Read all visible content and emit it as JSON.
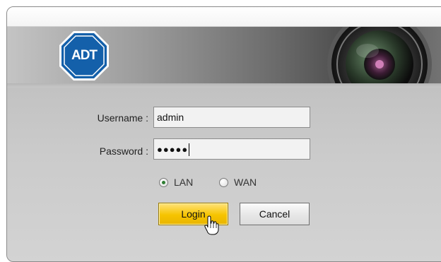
{
  "brand": {
    "logo_text": "ADT",
    "logo_color": "#1460aa"
  },
  "login_form": {
    "username_label": "Username :",
    "username_value": "admin",
    "password_label": "Password :",
    "password_masked": "●●●●●",
    "network_options": [
      {
        "label": "LAN",
        "selected": true
      },
      {
        "label": "WAN",
        "selected": false
      }
    ],
    "login_label": "Login",
    "cancel_label": "Cancel"
  },
  "colors": {
    "login_button": "#f6c400",
    "radio_selected": "#2e7d32"
  },
  "icons": {
    "logo": "adt-octagon-logo",
    "camera": "camera-lens-icon",
    "cursor": "hand-pointer-icon"
  }
}
